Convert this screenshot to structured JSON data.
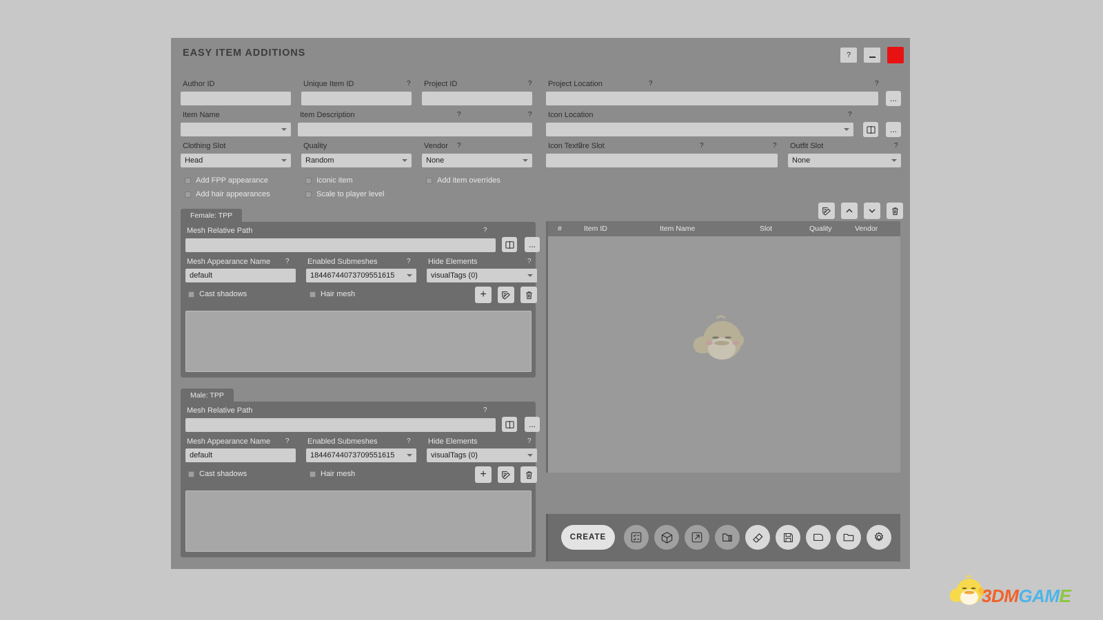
{
  "window": {
    "title": "EASY ITEM ADDITIONS",
    "help_label": "?",
    "minimize_label": "",
    "close_label": "",
    "accent_close_color": "#e81212",
    "panel_bg": "#8c8c8c",
    "subpanel_bg": "#6d6d6d",
    "field_bg": "#cfcfcf"
  },
  "top_form": {
    "author_id": {
      "label": "Author ID",
      "value": "",
      "hint": "?"
    },
    "unique_item_id": {
      "label": "Unique Item ID",
      "value": "",
      "hint": "?"
    },
    "project_id": {
      "label": "Project ID",
      "value": "",
      "hint": "?"
    },
    "project_location": {
      "label": "Project Location",
      "value": "",
      "hint": "?",
      "browse_label": "..."
    },
    "item_name": {
      "label": "Item Name",
      "value": "",
      "hint": "?"
    },
    "item_description": {
      "label": "Item Description",
      "value": "",
      "hint": "?"
    },
    "icon_location": {
      "label": "Icon Location",
      "value": "",
      "hint": "?",
      "browse_label": "..."
    },
    "clothing_slot": {
      "label": "Clothing Slot",
      "value": "Head",
      "hint": "?"
    },
    "quality": {
      "label": "Quality",
      "value": "Random",
      "hint": "?"
    },
    "vendor": {
      "label": "Vendor",
      "value": "None",
      "hint": "?"
    },
    "icon_texture_slot": {
      "label": "Icon Texture Slot",
      "value": "",
      "hint": "?"
    },
    "outfit_slot": {
      "label": "Outfit Slot",
      "value": "None",
      "hint": "?"
    }
  },
  "checkboxes": [
    {
      "label": "Add FPP appearance",
      "checked": false
    },
    {
      "label": "Add hair appearances",
      "checked": false
    },
    {
      "label": "Iconic item",
      "checked": false
    },
    {
      "label": "Scale to player level",
      "checked": false
    },
    {
      "label": "Add item overrides",
      "checked": false
    }
  ],
  "gender_panels": [
    {
      "tab_label": "Female: TPP",
      "mesh_relative_path": {
        "label": "Mesh Relative Path",
        "value": "",
        "hint": "?",
        "browse_label": "..."
      },
      "mesh_appearance_name": {
        "label": "Mesh Appearance Name",
        "value": "default",
        "hint": "?"
      },
      "enabled_submeshes": {
        "label": "Enabled Submeshes",
        "value": "18446744073709551615",
        "hint": "?"
      },
      "hide_elements": {
        "label": "Hide Elements",
        "value": "visualTags (0)",
        "hint": "?"
      },
      "cast_shadows": {
        "label": "Cast shadows",
        "checked": false
      },
      "hair_mesh": {
        "label": "Hair mesh",
        "checked": false
      },
      "add_label": "+"
    },
    {
      "tab_label": "Male: TPP",
      "mesh_relative_path": {
        "label": "Mesh Relative Path",
        "value": "",
        "hint": "?",
        "browse_label": "..."
      },
      "mesh_appearance_name": {
        "label": "Mesh Appearance Name",
        "value": "default",
        "hint": "?"
      },
      "enabled_submeshes": {
        "label": "Enabled Submeshes",
        "value": "18446744073709551615",
        "hint": "?"
      },
      "hide_elements": {
        "label": "Hide Elements",
        "value": "visualTags (0)",
        "hint": "?"
      },
      "cast_shadows": {
        "label": "Cast shadows",
        "checked": false
      },
      "hair_mesh": {
        "label": "Hair mesh",
        "checked": false
      },
      "add_label": "+"
    }
  ],
  "item_list": {
    "columns": [
      "#",
      "Item ID",
      "Item Name",
      "Slot",
      "Quality",
      "Vendor"
    ],
    "rows": []
  },
  "list_tools": [
    {
      "name": "edit-item-button",
      "icon": "edit-icon"
    },
    {
      "name": "move-up-button",
      "icon": "chevron-up-icon"
    },
    {
      "name": "move-down-button",
      "icon": "chevron-down-icon"
    },
    {
      "name": "delete-item-button",
      "icon": "trash-icon"
    }
  ],
  "action_bar": {
    "create_label": "CREATE",
    "buttons": [
      {
        "name": "validate-button",
        "icon": "checklist-icon"
      },
      {
        "name": "package-button",
        "icon": "box-icon"
      },
      {
        "name": "export-button",
        "icon": "export-icon"
      },
      {
        "name": "archive-button",
        "icon": "zip-icon"
      },
      {
        "name": "clear-button",
        "icon": "eraser-icon"
      },
      {
        "name": "save-button",
        "icon": "floppy-icon"
      },
      {
        "name": "new-button",
        "icon": "new-file-icon"
      },
      {
        "name": "open-button",
        "icon": "folder-icon"
      },
      {
        "name": "settings-button",
        "icon": "gear-icon"
      }
    ]
  },
  "watermark": {
    "text_o1": "3DM",
    "text_b": "GAM",
    "text_o2": "E"
  }
}
